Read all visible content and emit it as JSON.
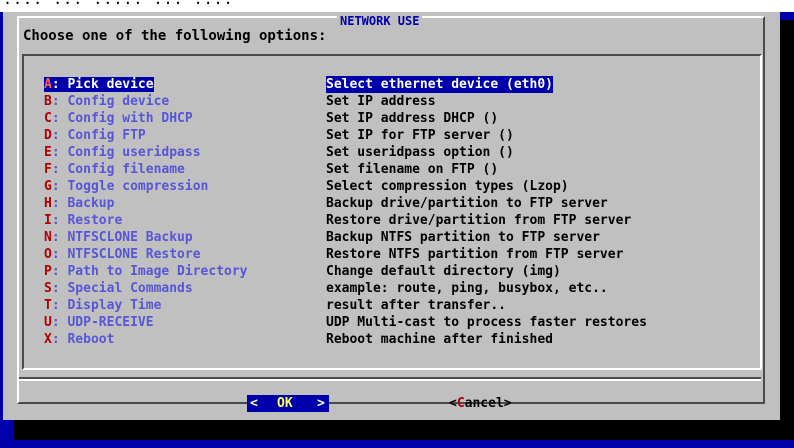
{
  "window": {
    "top_bar_text": "···· ··· ····· ··· ····"
  },
  "dialog": {
    "title": "NETWORK USE",
    "prompt": "Choose one of the following options:"
  },
  "menu": {
    "items": [
      {
        "key": "A",
        "tag": ": Pick device",
        "desc": "Select ethernet device (eth0)",
        "selected": true
      },
      {
        "key": "B",
        "tag": ": Config device",
        "desc": "Set IP address"
      },
      {
        "key": "C",
        "tag": ": Config with DHCP",
        "desc": "Set IP address DHCP ()"
      },
      {
        "key": "D",
        "tag": ": Config FTP",
        "desc": "Set IP for FTP server ()"
      },
      {
        "key": "E",
        "tag": ": Config useridpass",
        "desc": "Set useridpass option ()"
      },
      {
        "key": "F",
        "tag": ": Config filename",
        "desc": "Set filename on FTP ()"
      },
      {
        "key": "G",
        "tag": ": Toggle compression",
        "desc": "Select compression types (Lzop)"
      },
      {
        "key": "H",
        "tag": ": Backup",
        "desc": "Backup drive/partition to FTP server"
      },
      {
        "key": "I",
        "tag": ": Restore",
        "desc": "Restore drive/partition from FTP server"
      },
      {
        "key": "N",
        "tag": ": NTFSCLONE Backup",
        "desc": "Backup NTFS partition to FTP server"
      },
      {
        "key": "O",
        "tag": ": NTFSCLONE Restore",
        "desc": "Restore NTFS partition from FTP server"
      },
      {
        "key": "P",
        "tag": ": Path to Image Directory",
        "desc": "Change default directory (img)"
      },
      {
        "key": "S",
        "tag": ": Special Commands",
        "desc": "example: route, ping, busybox, etc.."
      },
      {
        "key": "T",
        "tag": ": Display Time",
        "desc": "result after transfer.."
      },
      {
        "key": "U",
        "tag": ": UDP-RECEIVE",
        "desc": "UDP Multi-cast to process faster restores"
      },
      {
        "key": "X",
        "tag": ": Reboot",
        "desc": "Reboot machine after finished"
      }
    ]
  },
  "buttons": {
    "ok": {
      "lt": "<",
      "label": "OK",
      "gt": ">"
    },
    "cancel": {
      "open": "<",
      "hot": "C",
      "rest": "ancel",
      "close": ">"
    }
  },
  "colors": {
    "background": "#0000aa",
    "dialog": "#c0c0c0",
    "title": "#0000aa",
    "hotkey": "#b00000",
    "item_tag": "#5656d6",
    "selection": "#0000aa"
  }
}
